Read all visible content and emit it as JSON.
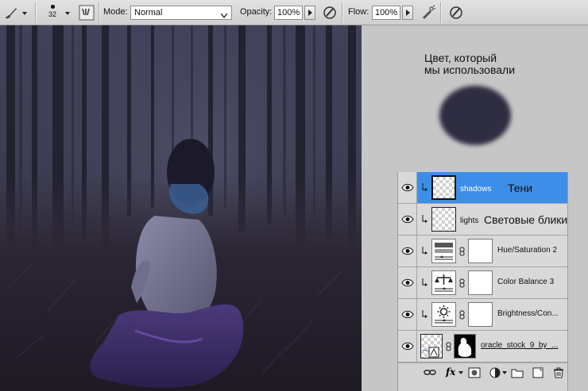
{
  "options_bar": {
    "brush_size": "32",
    "mode_label": "Mode:",
    "mode_value": "Normal",
    "opacity_label": "Opacity:",
    "opacity_value": "100%",
    "flow_label": "Flow:",
    "flow_value": "100%",
    "icons": [
      "brush-tool-icon",
      "brush-preset-icon",
      "brush-panel-icon",
      "pressure-opacity-icon",
      "airbrush-icon",
      "pressure-size-icon"
    ]
  },
  "annotation": {
    "text": "Цвет, который\nмы использовали",
    "swatch_color": "#2f2d42"
  },
  "layers": [
    {
      "name": "shadows",
      "annotation": "Тени",
      "type": "pixel",
      "clipped": true,
      "selected": true
    },
    {
      "name": "lights",
      "annotation": "Световые блики",
      "type": "pixel",
      "clipped": true,
      "selected": false
    },
    {
      "name": "Hue/Saturation 2",
      "annotation": "",
      "type": "hue-saturation",
      "clipped": true,
      "selected": false
    },
    {
      "name": "Color Balance 3",
      "annotation": "",
      "type": "color-balance",
      "clipped": true,
      "selected": false
    },
    {
      "name": "Brightness/Con...",
      "annotation": "",
      "type": "brightness-contrast",
      "clipped": true,
      "selected": false
    },
    {
      "name": "oracle_stock_9_by_...",
      "annotation": "",
      "type": "smart-object",
      "clipped": false,
      "selected": false
    }
  ],
  "layers_footer": {
    "fx_label": "fx",
    "icons": [
      "link-layers-icon",
      "fx-icon",
      "add-mask-icon",
      "new-adjustment-icon",
      "new-group-icon",
      "new-layer-icon",
      "trash-icon"
    ]
  },
  "colors": {
    "selection": "#3d8ee8",
    "panel_bg": "#d6d6d6"
  }
}
